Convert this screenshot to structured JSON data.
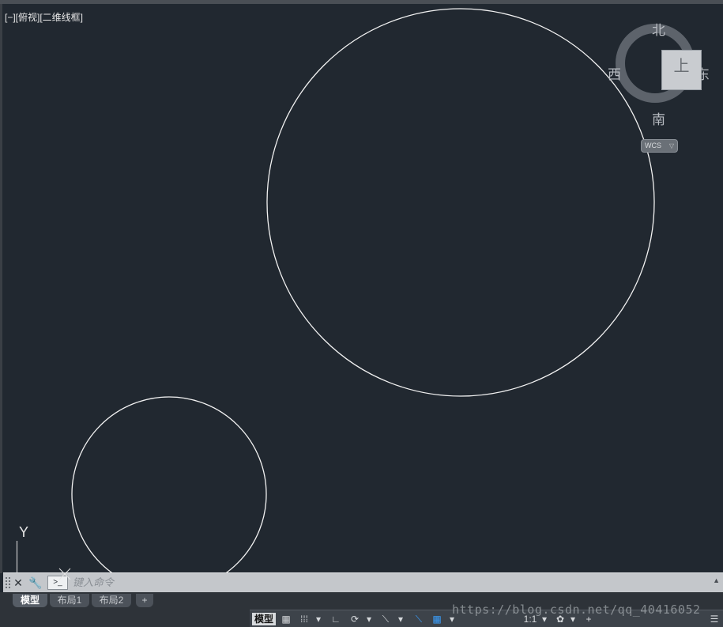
{
  "viewport": {
    "label": "[−][俯视][二维线框]"
  },
  "viewcube": {
    "north": "北",
    "south": "南",
    "west": "西",
    "east": "东",
    "face_label": "上",
    "wcs_label": "WCS",
    "wcs_caret": "▽"
  },
  "ucs": {
    "y_label": "Y",
    "x_mark": "×"
  },
  "command_line": {
    "close_icon": "✕",
    "tool_icon": "🔧",
    "prompt_icon": ">_",
    "placeholder": "键入命令",
    "scroll_icon": "▲"
  },
  "layout_tabs": [
    {
      "label": "模型",
      "active": true
    },
    {
      "label": "布局1",
      "active": false
    },
    {
      "label": "布局2",
      "active": false
    }
  ],
  "add_tab_label": "+",
  "statusbar": {
    "model_label": "模型",
    "grid_icon": "▦",
    "snap_icon": "⁞⁞⁞",
    "ortho_icon": "∟",
    "polar_icon": "⟳",
    "osnap_icon": "⟍",
    "annot_scale": "1:1",
    "gear_icon": "✿",
    "plus_icon": "+",
    "more_icon": "☰",
    "dropdown_icon": "▾"
  },
  "watermark": "https://blog.csdn.net/qq_40416052",
  "colors": {
    "background": "#212830",
    "circle_stroke": "#f2f2f2",
    "accent_blue": "#3aa0ff"
  }
}
